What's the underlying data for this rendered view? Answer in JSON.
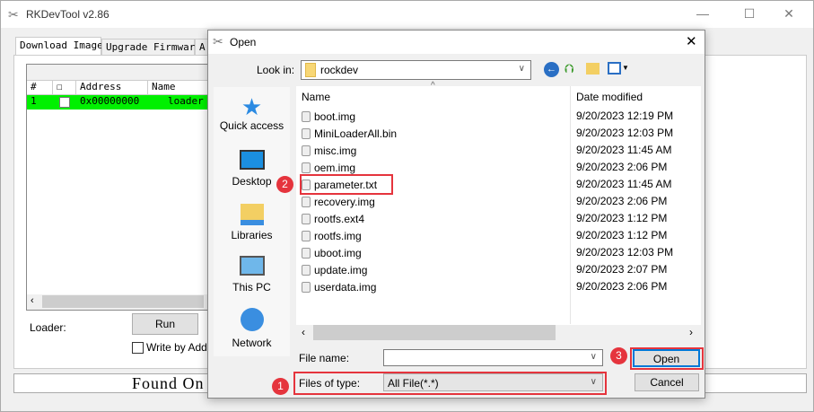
{
  "main_window": {
    "title": "RKDevTool v2.86",
    "controls": {
      "minimize": "—",
      "maximize": "☐",
      "close": "✕"
    },
    "tabs": [
      {
        "label": "Download Image",
        "active": true
      },
      {
        "label": "Upgrade Firmware"
      },
      {
        "label": "A"
      }
    ],
    "table": {
      "headers": [
        "#",
        "☐",
        "Address",
        "Name"
      ],
      "rows": [
        {
          "num": "1",
          "checked": false,
          "address": "0x00000000",
          "name": "loader",
          "color": "#00f000"
        }
      ]
    },
    "loader_label": "Loader:",
    "run_button": "Run",
    "write_by_addr": "Write by Addr",
    "status": "Found On"
  },
  "dialog": {
    "title": "Open",
    "close": "✕",
    "look_in_label": "Look in:",
    "look_in_value": "rockdev",
    "places": [
      {
        "label": "Quick access",
        "icon": "star-icon"
      },
      {
        "label": "Desktop",
        "icon": "desktop-icon"
      },
      {
        "label": "Libraries",
        "icon": "libraries-icon"
      },
      {
        "label": "This PC",
        "icon": "computer-icon"
      },
      {
        "label": "Network",
        "icon": "network-icon"
      }
    ],
    "columns": {
      "name": "Name",
      "date": "Date modified"
    },
    "files": [
      {
        "name": "boot.img",
        "date": "9/20/2023 12:19 PM"
      },
      {
        "name": "MiniLoaderAll.bin",
        "date": "9/20/2023 12:03 PM"
      },
      {
        "name": "misc.img",
        "date": "9/20/2023 11:45 AM"
      },
      {
        "name": "oem.img",
        "date": "9/20/2023 2:06 PM"
      },
      {
        "name": "parameter.txt",
        "date": "9/20/2023 11:45 AM"
      },
      {
        "name": "recovery.img",
        "date": "9/20/2023 2:06 PM"
      },
      {
        "name": "rootfs.ext4",
        "date": "9/20/2023 1:12 PM"
      },
      {
        "name": "rootfs.img",
        "date": "9/20/2023 1:12 PM"
      },
      {
        "name": "uboot.img",
        "date": "9/20/2023 12:03 PM"
      },
      {
        "name": "update.img",
        "date": "9/20/2023 2:07 PM"
      },
      {
        "name": "userdata.img",
        "date": "9/20/2023 2:06 PM"
      }
    ],
    "file_name_label": "File name:",
    "file_name_value": "",
    "files_of_type_label": "Files of type:",
    "files_of_type_value": "All File(*.*)",
    "open_button": "Open",
    "cancel_button": "Cancel"
  },
  "annotations": {
    "step1": "1",
    "step2": "2",
    "step3": "3",
    "color": "#e5343d"
  }
}
